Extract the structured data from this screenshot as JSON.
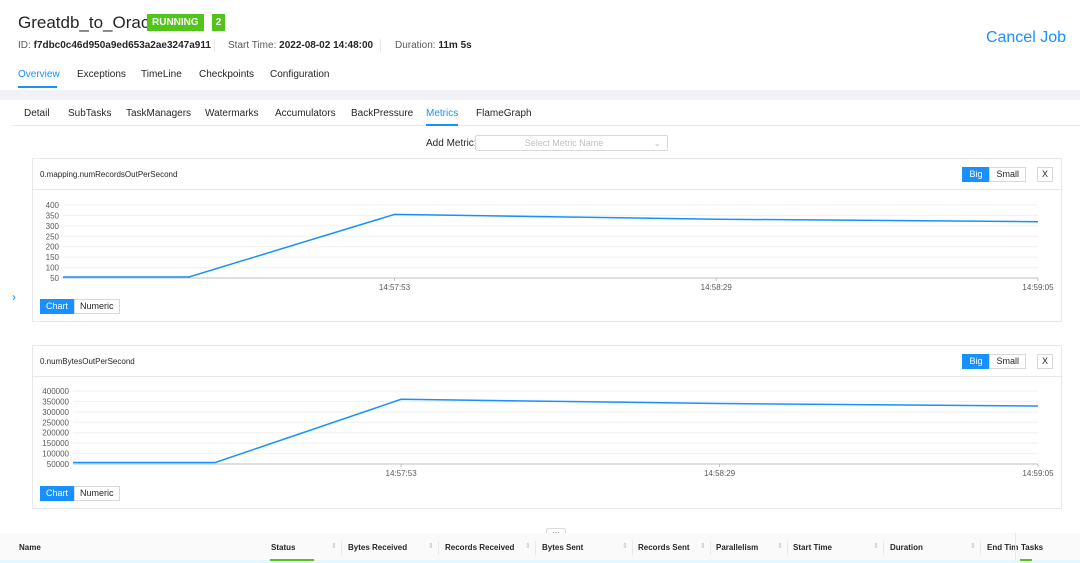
{
  "job": {
    "name": "Greatdb_to_Oracle",
    "status": "RUNNING",
    "status_count": "2",
    "id_label": "ID:",
    "id_value": "f7dbc0c46d950a9ed653a2ae3247a911",
    "start_label": "Start Time:",
    "start_value": "2022-08-02 14:48:00",
    "duration_label": "Duration:",
    "duration_value": "11m 5s",
    "cancel_label": "Cancel Job"
  },
  "top_tabs": [
    "Overview",
    "Exceptions",
    "TimeLine",
    "Checkpoints",
    "Configuration"
  ],
  "sub_tabs": [
    "Detail",
    "SubTasks",
    "TaskManagers",
    "Watermarks",
    "Accumulators",
    "BackPressure",
    "Metrics",
    "FlameGraph"
  ],
  "add_metric": {
    "label": "Add Metric:",
    "placeholder": "Select Metric Name"
  },
  "size_buttons": {
    "big": "Big",
    "small": "Small",
    "close": "X"
  },
  "view_buttons": {
    "chart": "Chart",
    "numeric": "Numeric"
  },
  "expand_label": "...",
  "table_headers": [
    "Name",
    "Status",
    "Bytes Received",
    "Records Received",
    "Bytes Sent",
    "Records Sent",
    "Parallelism",
    "Start Time",
    "Duration",
    "End Tim",
    "Tasks"
  ],
  "colors": {
    "accent": "#1890ff",
    "running": "#52c41a"
  },
  "chart_data": [
    {
      "type": "line",
      "title": "0.mapping.numRecordsOutPerSecond",
      "x": [
        "14:57:25",
        "14:57:30",
        "14:57:53",
        "14:58:29",
        "14:59:05"
      ],
      "x_ticks": [
        "14:57:53",
        "14:58:29",
        "14:59:05"
      ],
      "y_ticks": [
        "400",
        "350",
        "300",
        "250",
        "200",
        "150",
        "100",
        "50"
      ],
      "ylim": [
        50,
        400
      ],
      "values": [
        55,
        55,
        355,
        332,
        320
      ],
      "grid": true
    },
    {
      "type": "line",
      "title": "0.numBytesOutPerSecond",
      "x": [
        "14:57:26",
        "14:57:32",
        "14:57:53",
        "14:58:29",
        "14:59:05"
      ],
      "x_ticks": [
        "14:57:53",
        "14:58:29",
        "14:59:05"
      ],
      "y_ticks": [
        "400000",
        "350000",
        "300000",
        "250000",
        "200000",
        "150000",
        "100000",
        "50000"
      ],
      "ylim": [
        50000,
        400000
      ],
      "values": [
        57000,
        57000,
        360000,
        340000,
        328000
      ],
      "grid": true
    }
  ]
}
